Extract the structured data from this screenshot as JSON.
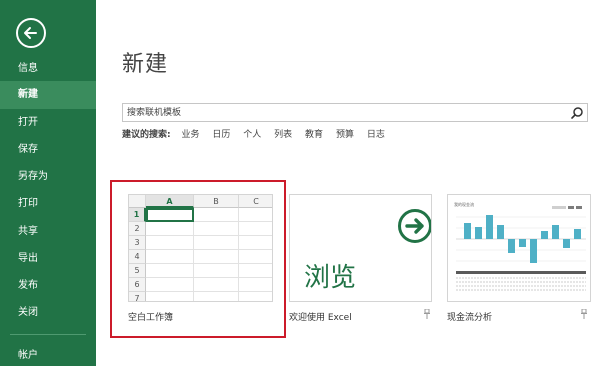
{
  "sidebar": {
    "items": [
      {
        "label": "信息",
        "active": false
      },
      {
        "label": "新建",
        "active": true
      },
      {
        "label": "打开",
        "active": false
      },
      {
        "label": "保存",
        "active": false
      },
      {
        "label": "另存为",
        "active": false
      },
      {
        "label": "打印",
        "active": false
      },
      {
        "label": "共享",
        "active": false
      },
      {
        "label": "导出",
        "active": false
      },
      {
        "label": "发布",
        "active": false
      },
      {
        "label": "关闭",
        "active": false
      },
      {
        "label": "帐户",
        "active": false
      }
    ],
    "back_icon": "back-arrow-icon"
  },
  "main": {
    "title": "新建",
    "search": {
      "placeholder": "搜索联机模板",
      "value": ""
    },
    "suggestions": {
      "label": "建议的搜索:",
      "tags": [
        "业务",
        "日历",
        "个人",
        "列表",
        "教育",
        "预算",
        "日志"
      ]
    },
    "templates": [
      {
        "label": "空白工作簿",
        "columns": [
          "A",
          "B",
          "C"
        ],
        "rows": [
          "1",
          "2",
          "3",
          "4",
          "5",
          "6",
          "7"
        ],
        "selected_column": "A",
        "selected_row": "1",
        "highlighted": true
      },
      {
        "label": "欢迎使用 Excel",
        "preview_text": "浏览",
        "pinned": false
      },
      {
        "label": "现金流分析",
        "preview_title": "我的现金流",
        "pinned": false
      }
    ]
  },
  "colors": {
    "brand": "#217346",
    "active_nav": "#3a8c5d",
    "highlight": "#cc1b2a",
    "teal": "#4fb0c6"
  }
}
